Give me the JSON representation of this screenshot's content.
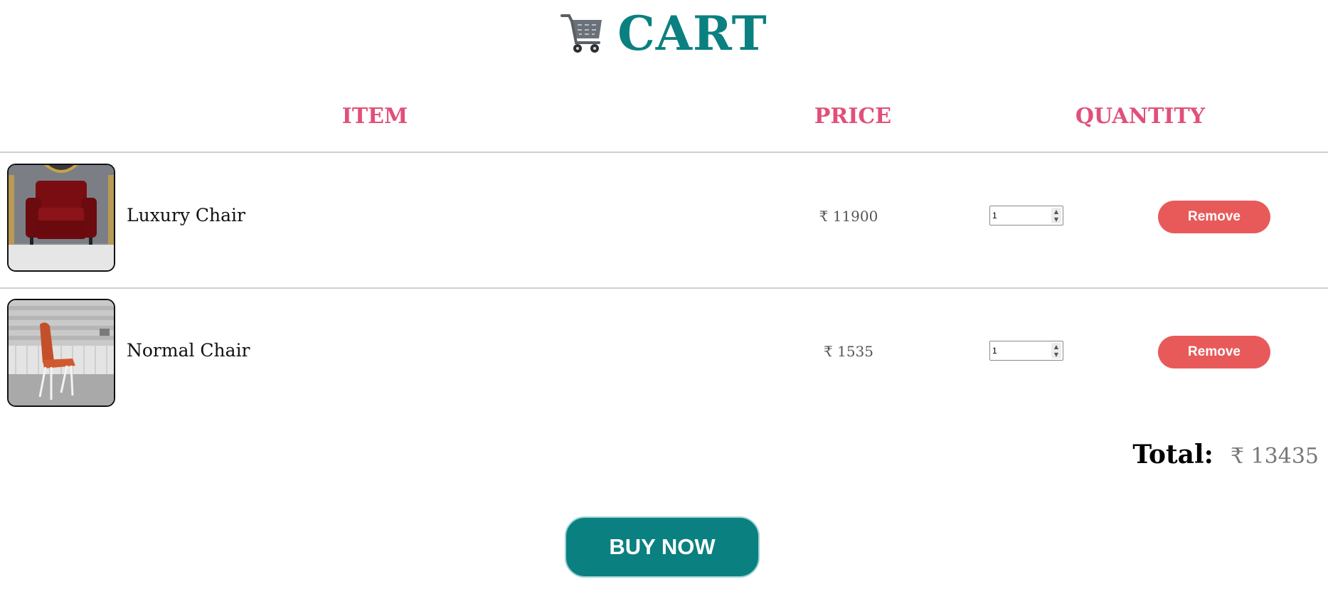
{
  "header": {
    "title": "CART",
    "icon": "shopping-cart-icon"
  },
  "table": {
    "columns": [
      "ITEM",
      "PRICE",
      "QUANTITY"
    ]
  },
  "items": [
    {
      "name": "Luxury Chair",
      "price": "₹ 11900",
      "quantity": "1",
      "remove_label": "Remove",
      "image": "red-armchair-image"
    },
    {
      "name": "Normal Chair",
      "price": "₹ 1535",
      "quantity": "1",
      "remove_label": "Remove",
      "image": "orange-chair-image"
    }
  ],
  "total": {
    "label": "Total:",
    "value": "₹ 13435"
  },
  "buy_label": "BUY NOW",
  "colors": {
    "accent": "#0b8080",
    "header": "#e0507a",
    "remove": "#e85a5a"
  }
}
